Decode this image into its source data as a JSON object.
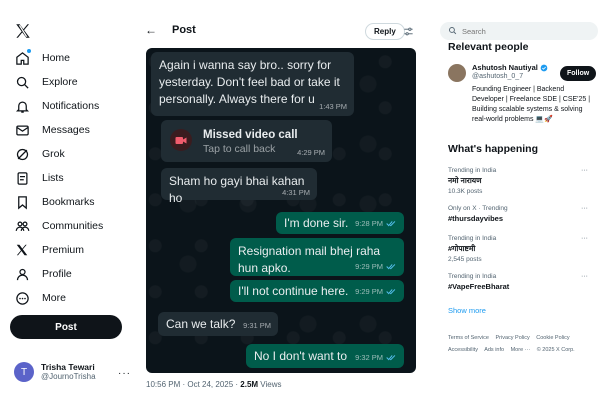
{
  "nav": {
    "items": [
      {
        "label": "Home",
        "icon": "home-icon"
      },
      {
        "label": "Explore",
        "icon": "search-icon"
      },
      {
        "label": "Notifications",
        "icon": "bell-icon"
      },
      {
        "label": "Messages",
        "icon": "mail-icon"
      },
      {
        "label": "Grok",
        "icon": "grok-icon"
      },
      {
        "label": "Lists",
        "icon": "list-icon"
      },
      {
        "label": "Bookmarks",
        "icon": "bookmark-icon"
      },
      {
        "label": "Communities",
        "icon": "communities-icon"
      },
      {
        "label": "Premium",
        "icon": "x-icon"
      },
      {
        "label": "Profile",
        "icon": "person-icon"
      },
      {
        "label": "More",
        "icon": "more-circle-icon"
      }
    ],
    "post_label": "Post"
  },
  "account": {
    "initial": "T",
    "name": "Trisha Tewari",
    "handle": "@JournoTrisha",
    "more": "···"
  },
  "header": {
    "title": "Post",
    "reply_label": "Reply"
  },
  "chat": {
    "messages": [
      {
        "dir": "in",
        "text": "Again i wanna say bro.. sorry for yesterday. Don't feel bad or take it personally. Always there for u",
        "time": "1:43 PM"
      },
      {
        "dir": "in",
        "type": "call",
        "title": "Missed video call",
        "subtitle": "Tap to call back",
        "time": "4:29 PM"
      },
      {
        "dir": "in",
        "text": "Sham ho gayi bhai kahan ho",
        "time": "4:31 PM"
      },
      {
        "dir": "out",
        "text": "I'm done sir.",
        "time": "9:28 PM"
      },
      {
        "dir": "out",
        "text": "Resignation mail bhej raha hun apko.",
        "time": "9:29 PM"
      },
      {
        "dir": "out",
        "text": "I'll not continue here.",
        "time": "9:29 PM"
      },
      {
        "dir": "in",
        "text": "Can we talk?",
        "time": "9:31 PM"
      },
      {
        "dir": "out",
        "text": "No I don't want to",
        "time": "9:32 PM"
      }
    ]
  },
  "meta": {
    "timestamp": "10:56 PM · Oct 24, 2025 · ",
    "views": "2.5M",
    "views_label": " Views"
  },
  "search": {
    "placeholder": "Search"
  },
  "relevant": {
    "title": "Relevant people",
    "name": "Ashutosh Nautiyal",
    "handle": "@ashutosh_0_7",
    "bio": "Founding Engineer | Backend Developer | Freelance SDE | CSE'25 | Building scalable systems & solving real-world problems 💻🚀",
    "follow_label": "Follow"
  },
  "happening": {
    "title": "What's happening",
    "trends": [
      {
        "context": "Trending in India",
        "name": "नमो नारायण",
        "count": "10.3K posts"
      },
      {
        "context": "Only on X · Trending",
        "name": "#thursdayvibes",
        "count": ""
      },
      {
        "context": "Trending in India",
        "name": "#गोपाष्टमी",
        "count": "2,545 posts"
      },
      {
        "context": "Trending in India",
        "name": "#VapeFreeBharat",
        "count": ""
      }
    ],
    "more_glyph": "···",
    "show_more": "Show more"
  },
  "footer": {
    "links": [
      "Terms of Service",
      "Privacy Policy",
      "Cookie Policy",
      "Accessibility",
      "Ads info",
      "More ···",
      "© 2025 X Corp."
    ]
  },
  "colors": {
    "accent": "#1d9bf0",
    "chat_bg": "#0b141a",
    "bubble_in": "#202c33",
    "bubble_out": "#005c4b",
    "missed_call": "#f15c6d"
  }
}
